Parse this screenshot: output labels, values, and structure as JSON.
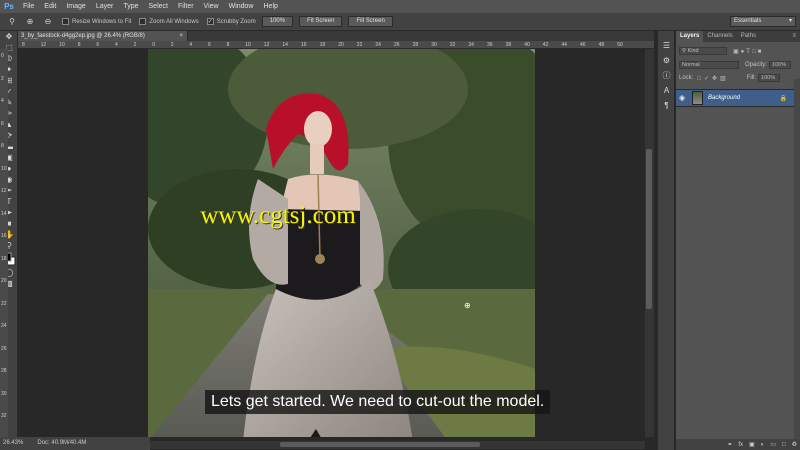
{
  "app": {
    "logo": "Ps"
  },
  "menu": [
    "File",
    "Edit",
    "Image",
    "Layer",
    "Type",
    "Select",
    "Filter",
    "View",
    "Window",
    "Help"
  ],
  "options": {
    "resize_windows": "Resize Windows to Fit",
    "zoom_all_windows": "Zoom All Windows",
    "scrubby_zoom": "Scrubby Zoom",
    "scrubby_check": "✓",
    "btn_100": "100%",
    "btn_fit": "Fit Screen",
    "btn_fill": "Fill Screen",
    "workspace": "Essentials"
  },
  "document": {
    "tab_title": "3_by_faestock-d4gg2ep.jpg @ 26.4% (RGB/8)",
    "close": "×"
  },
  "ruler": {
    "h_ticks": [
      "8",
      "12",
      "10",
      "8",
      "6",
      "4",
      "2",
      "0",
      "2",
      "4",
      "6",
      "8",
      "10",
      "12",
      "14",
      "16",
      "18",
      "20",
      "22",
      "24",
      "26",
      "28",
      "30",
      "32",
      "34",
      "36",
      "38",
      "40",
      "42",
      "44",
      "46",
      "48",
      "50"
    ],
    "v_ticks": [
      "0",
      "2",
      "4",
      "6",
      "8",
      "10",
      "12",
      "14",
      "16",
      "18",
      "20",
      "22",
      "24",
      "26",
      "28",
      "30",
      "32"
    ]
  },
  "canvas": {
    "watermark": "www.cgtsj.com",
    "subtitle": "Lets get started. We need to cut-out the model."
  },
  "status": {
    "zoom": "26.43%",
    "doc": "Doc: 40.9M/40.4M"
  },
  "layers_panel": {
    "tabs": [
      "Layers",
      "Channels",
      "Paths"
    ],
    "kind_label": "Kind",
    "blend_mode": "Normal",
    "opacity_label": "Opacity:",
    "opacity_value": "100%",
    "lock_label": "Lock:",
    "fill_label": "Fill:",
    "fill_value": "100%",
    "layer_name": "Background",
    "footer_icons": [
      "link-icon",
      "fx-icon",
      "mask-icon",
      "adjustment-icon",
      "group-icon",
      "new-layer-icon",
      "trash-icon"
    ]
  },
  "colors": {
    "accent": "#3f5f8a",
    "watermark": "#f5f500",
    "ps_blue": "#6cb4ff"
  }
}
